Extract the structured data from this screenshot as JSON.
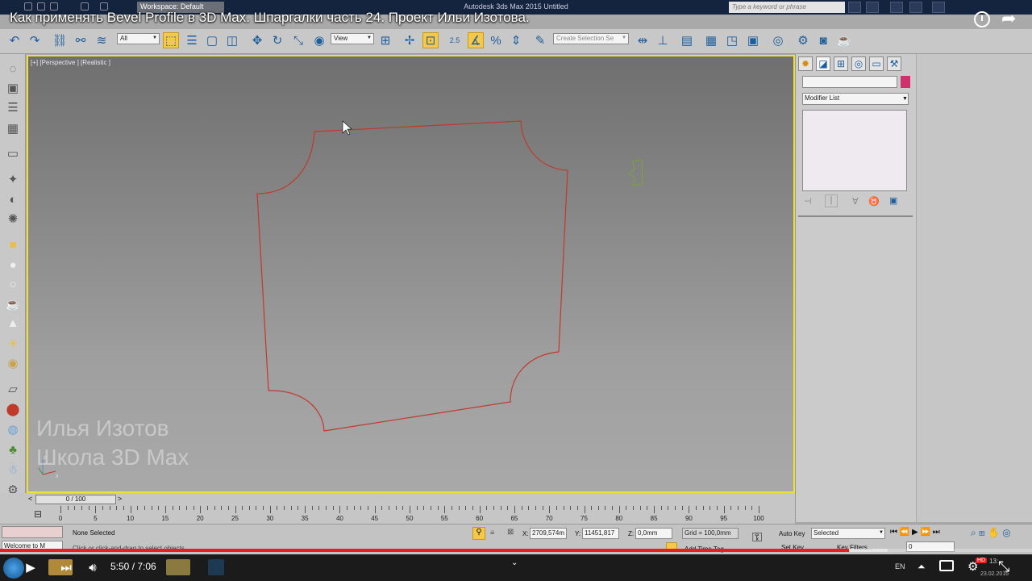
{
  "window": {
    "app_title": "Autodesk 3ds Max 2015    Untitled",
    "workspace": "Workspace: Default",
    "search_placeholder": "Type a keyword or phrase"
  },
  "video": {
    "title": "Как применять Bevel Profile в 3D Max. Шпаргалки часть 24. Проект Ильи Изотова.",
    "time": "5:50 / 7:06",
    "progress": 0.823,
    "buffered": 0.86,
    "hd_badge": "HD"
  },
  "toolbar": {
    "filter": "All",
    "reference": "View",
    "selection_set": "Create Selection Se",
    "snap_label": "2.5"
  },
  "viewport": {
    "label": "[+] [Perspective ] [Realistic ]",
    "shape_color": "#c0392b",
    "helper_color": "#7ba23f",
    "watermark_line1": "Илья Изотов",
    "watermark_line2": "Школа 3D Max",
    "axis_z": "z",
    "axis_x": "x"
  },
  "command_panel": {
    "modifier_list": "Modifier List",
    "name_color": "#d0306b"
  },
  "timeline": {
    "slider": "0 / 100",
    "ruler_ticks": [
      "0",
      "5",
      "10",
      "15",
      "20",
      "25",
      "30",
      "35",
      "40",
      "45",
      "50",
      "55",
      "60",
      "65",
      "70",
      "75",
      "80",
      "85",
      "90",
      "95",
      "100"
    ]
  },
  "status": {
    "selection": "None Selected",
    "prompt": "Click or click-and-drag to select objects",
    "script": "Welcome to M",
    "x_label": "X:",
    "x_value": "2709,574m",
    "y_label": "Y:",
    "y_value": "11451,817",
    "z_label": "Z:",
    "z_value": "0,0mm",
    "grid": "Grid = 100,0mm",
    "add_time_tag": "Add Time Tag",
    "auto_key": "Auto Key",
    "set_key": "Set Key",
    "key_mode": "Selected",
    "key_filters": "Key Filters...",
    "frame": "0"
  },
  "tray": {
    "lang": "EN",
    "clock": "13:...",
    "date": "23.02.2016"
  }
}
